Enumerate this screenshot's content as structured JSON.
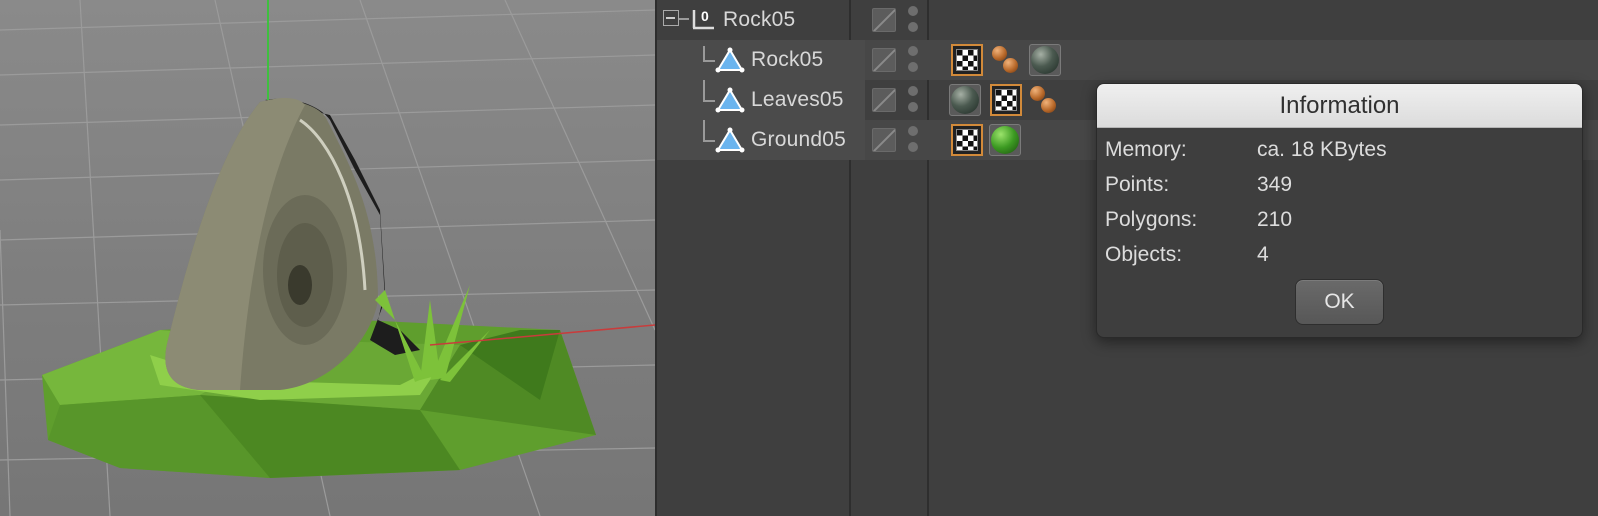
{
  "viewport": {
    "description_icons": [
      "rock-model",
      "grass-model"
    ]
  },
  "object_manager": {
    "rows": [
      {
        "name": "Rock05",
        "type": "null-object",
        "icon": "null-icon",
        "tags": []
      },
      {
        "name": "Rock05",
        "type": "polygon-object",
        "icon": "polygon-icon",
        "tags": [
          "texture-tag",
          "material-dots-tag",
          "rock-material-tag"
        ]
      },
      {
        "name": "Leaves05",
        "type": "polygon-object",
        "icon": "polygon-icon",
        "tags": [
          "rock-material-tag",
          "texture-tag",
          "material-dots-tag"
        ]
      },
      {
        "name": "Ground05",
        "type": "polygon-object",
        "icon": "polygon-icon",
        "tags": [
          "texture-tag",
          "green-material-tag"
        ]
      }
    ],
    "null_glyph": "0"
  },
  "dialog": {
    "title": "Information",
    "fields": [
      {
        "label": "Memory:",
        "value": "ca. 18 KBytes"
      },
      {
        "label": "Points:",
        "value": "349"
      },
      {
        "label": "Polygons:",
        "value": "210"
      },
      {
        "label": "Objects:",
        "value": "4"
      }
    ],
    "ok_label": "OK"
  },
  "colors": {
    "texture_tag_border": "#d28a3a",
    "polygon_icon": "#6ab4ee",
    "ground_green": "#6fbf3a"
  }
}
